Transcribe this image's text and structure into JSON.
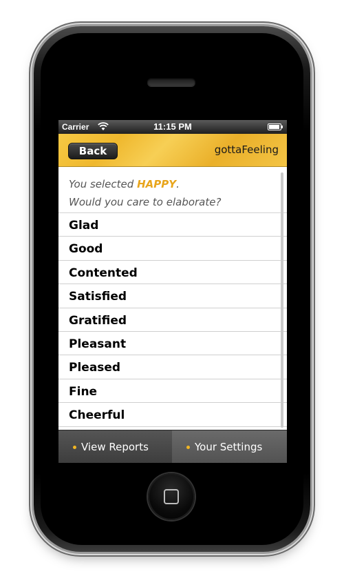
{
  "status_bar": {
    "carrier": "Carrier",
    "time": "11:15 PM"
  },
  "nav_bar": {
    "back_label": "Back",
    "title": "gottaFeeling"
  },
  "prompt": {
    "prefix": "You selected ",
    "emotion": "HAPPY",
    "suffix": ".",
    "question": "Would you care to elaborate?"
  },
  "feelings": [
    {
      "label": "Glad"
    },
    {
      "label": "Good"
    },
    {
      "label": "Contented"
    },
    {
      "label": "Satisfied"
    },
    {
      "label": "Gratified"
    },
    {
      "label": "Pleasant"
    },
    {
      "label": "Pleased"
    },
    {
      "label": "Fine"
    },
    {
      "label": "Cheerful"
    }
  ],
  "tabs": [
    {
      "label": "View Reports"
    },
    {
      "label": "Your Settings"
    }
  ],
  "colors": {
    "accent": "#e8a51c",
    "nav_bar": "#f2c040",
    "tab_bar": "#4a4a4a"
  },
  "icons": [
    "wifi-icon",
    "battery-icon",
    "home-button-icon"
  ]
}
